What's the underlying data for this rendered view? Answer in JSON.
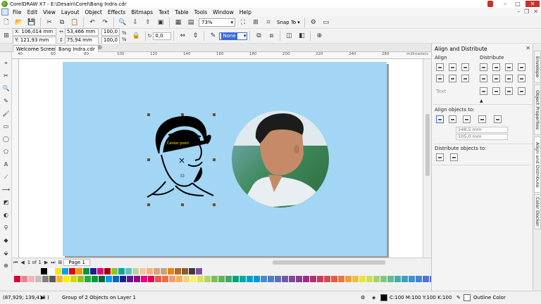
{
  "window": {
    "title": "CorelDRAW X7 - E:\\Desain\\Corel\\Bang Indra.cdr"
  },
  "menu": [
    "File",
    "Edit",
    "View",
    "Layout",
    "Object",
    "Effects",
    "Bitmaps",
    "Text",
    "Table",
    "Tools",
    "Window",
    "Help"
  ],
  "toolbar": {
    "zoom": "73%",
    "snap_to": "Snap To"
  },
  "property_bar": {
    "x": "X: 106,014 mm",
    "y": "Y: 121,93 mm",
    "width": "53,466 mm",
    "height": "75,94 mm",
    "scale_w": "100,0",
    "scale_h": "100,0",
    "percent": "%",
    "angle": "0,0",
    "outline": "None"
  },
  "tabs": {
    "welcome": "Welcome Screen",
    "document": "Bang Indra.cdr"
  },
  "ruler": {
    "h_ticks": [
      "40",
      "60",
      "80",
      "100",
      "120",
      "140",
      "160",
      "180",
      "200",
      "220",
      "240",
      "260"
    ],
    "unit": "millimeters"
  },
  "canvas": {
    "page_color": "#a2d6f4",
    "drawing_label": "Center point"
  },
  "pagenav": {
    "count": "1 of 1",
    "page_tab": "Page 1"
  },
  "docker": {
    "title": "Align and Distribute",
    "align": "Align",
    "distribute": "Distribute",
    "text": "Text",
    "align_to": "Align objects to:",
    "pos_x": "148,5 mm",
    "pos_y": "105,0 mm",
    "dist_to": "Distribute objects to:"
  },
  "side_tabs": [
    "Envelope",
    "Object Properties",
    "Align and Distribute",
    "Color Docker"
  ],
  "status": {
    "coords": "(87,929; 139,418 )",
    "selection": "Group of 2 Objects on Layer 1",
    "fill": "C:100 M:100 Y:100 K:100",
    "outline": "Outline Color"
  },
  "palette_row1": [
    "#000000",
    "#ffffff",
    "#ffe600",
    "#00a0e9",
    "#e60012",
    "#f39800",
    "#009944",
    "#1d2088",
    "#e4007f",
    "#a40000",
    "#8fc31f",
    "#00a7a0",
    "#61c0bf",
    "#b4d6a3",
    "#f7c5a0",
    "#f6b37f",
    "#d9a37f",
    "#c8a27a",
    "#f08300",
    "#b3692a",
    "#8c5b2e",
    "#3e3a39",
    "#7f4f9f"
  ],
  "palette_row2": [
    "#d7003a",
    "#ef858c",
    "#f5b2b2",
    "#c0c0c0",
    "#808080",
    "#595757",
    "#f8b62d",
    "#fff100",
    "#cfdb00",
    "#8fc31f",
    "#22ac38",
    "#009944",
    "#006934",
    "#00a0e9",
    "#0068b7",
    "#1d2088",
    "#601986",
    "#920783",
    "#e4007f",
    "#e5004f",
    "#ea5550",
    "#ed6d3d",
    "#f29b76",
    "#f6ae54",
    "#f3d37d",
    "#fcf16e",
    "#dbe159",
    "#b3d465",
    "#7fbe56",
    "#5fb15b",
    "#43a766",
    "#00a381",
    "#00a8a8",
    "#00a1c9",
    "#0098d7",
    "#3e8ed0",
    "#4f7ec2",
    "#5e6fb5",
    "#6c5ba7",
    "#7b4b9a",
    "#8b3d8e",
    "#9b2f82",
    "#b22f70",
    "#c93a5c",
    "#d8494d",
    "#e35c43",
    "#e97a3c",
    "#eda03a",
    "#eec13b",
    "#ece042",
    "#cadf54",
    "#a7d36a",
    "#84c67f",
    "#63ba93",
    "#47adaa",
    "#3ba0bf",
    "#3b92cf",
    "#4284d8",
    "#4d75d8",
    "#5b66d1",
    "#6b59c6",
    "#7b4db9",
    "#8b43ab"
  ]
}
